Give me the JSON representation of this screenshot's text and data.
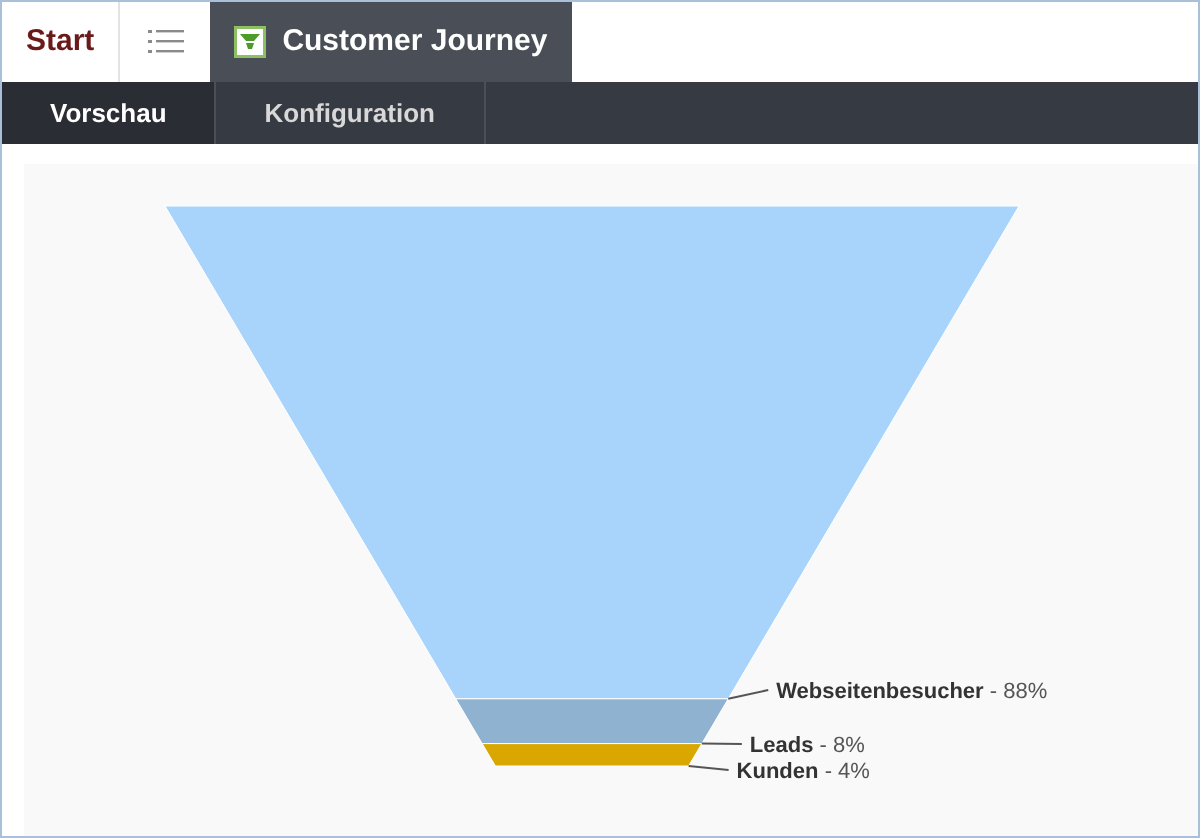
{
  "tabs": [
    {
      "label": "Start",
      "selected": false
    },
    {
      "label": "Customer Journey",
      "selected": true
    }
  ],
  "subtabs": [
    {
      "label": "Vorschau",
      "selected": true
    },
    {
      "label": "Konfiguration",
      "selected": false
    }
  ],
  "funnel": {
    "segments": [
      {
        "name": "Webseitenbesucher",
        "value": "- 88%",
        "color": "#a8d4fb"
      },
      {
        "name": "Leads",
        "value": "- 8%",
        "color": "#8eb2d0"
      },
      {
        "name": "Kunden",
        "value": "- 4%",
        "color": "#d9a700"
      }
    ]
  }
}
